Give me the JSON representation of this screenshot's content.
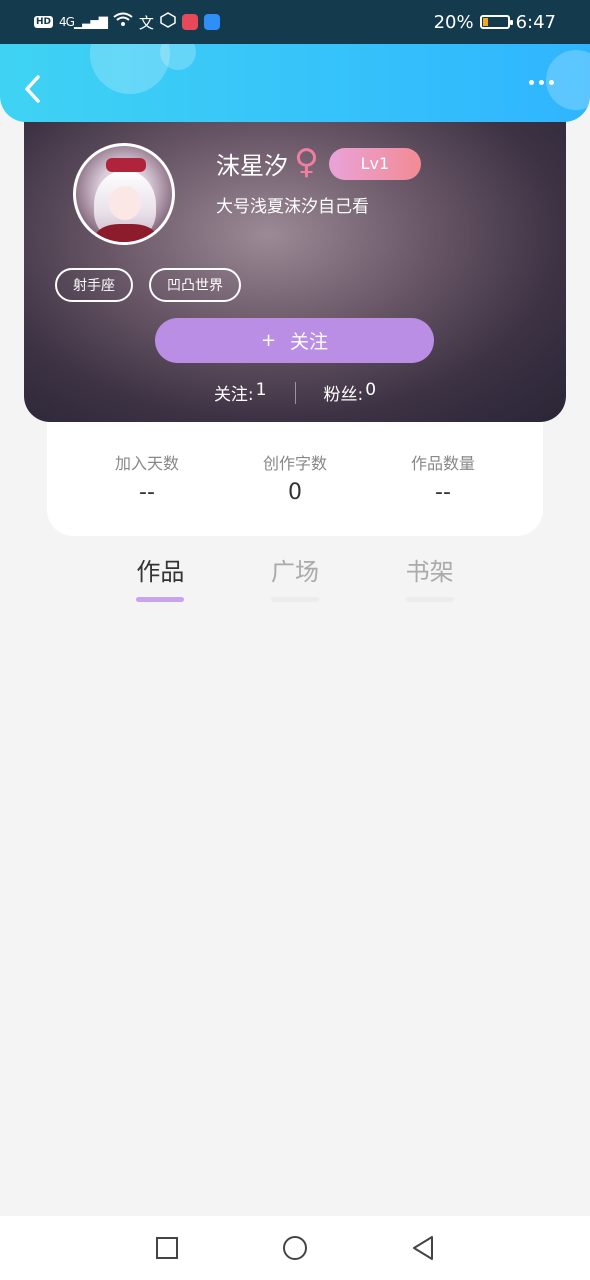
{
  "status_bar": {
    "network": "HD",
    "signal": "4G",
    "battery": "20%",
    "battery_level": 0.2,
    "time": "6:47"
  },
  "header": {
    "back_icon": "chevron-left-icon",
    "more_icon": "more-horizontal-icon"
  },
  "profile": {
    "name": "沫星汐",
    "gender_symbol": "♀",
    "level": "Lv1",
    "signature": "大号浅夏沫汐自己看",
    "tags": [
      "射手座",
      "凹凸世界"
    ],
    "follow_plus": "+",
    "follow_label": "关注",
    "following_label": "关注:",
    "following_count": "1",
    "fans_label": "粉丝:",
    "fans_count": "0"
  },
  "stats": [
    {
      "label": "加入天数",
      "value": "--"
    },
    {
      "label": "创作字数",
      "value": "0"
    },
    {
      "label": "作品数量",
      "value": "--"
    }
  ],
  "tabs": [
    {
      "label": "作品",
      "active": true
    },
    {
      "label": "广场",
      "active": false
    },
    {
      "label": "书架",
      "active": false
    }
  ],
  "colors": {
    "header_start": "#3fd3f3",
    "header_end": "#2fb5ff",
    "follow_button": "#bb8ee6",
    "tab_indicator": "#c9a3ec",
    "gender": "#f07ea0"
  }
}
